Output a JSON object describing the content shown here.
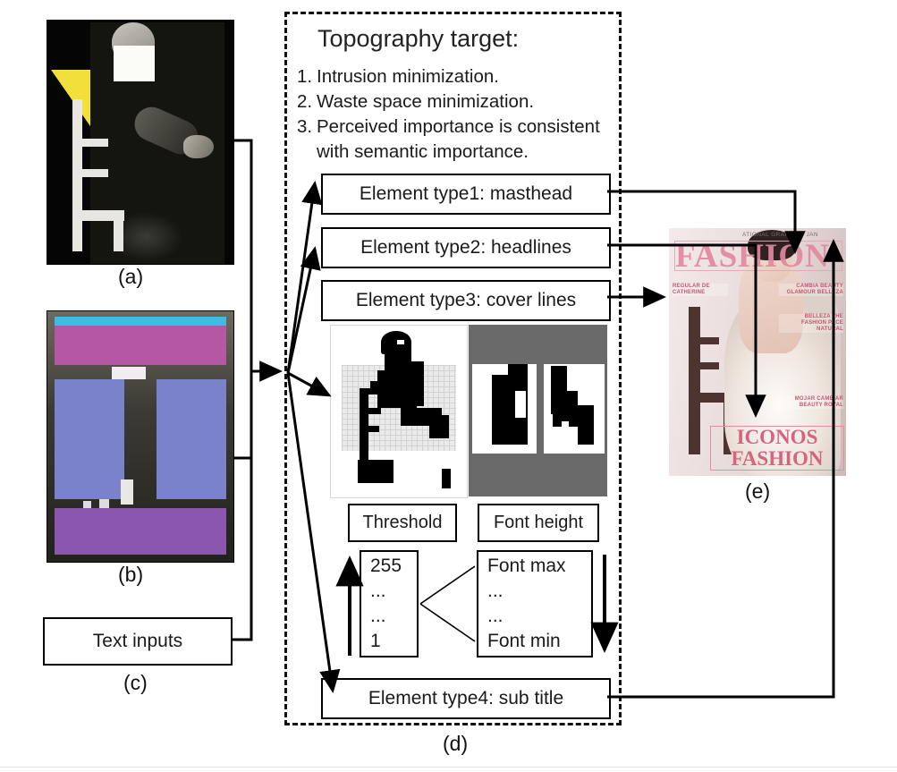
{
  "figure": {
    "panel_labels": {
      "a": "(a)",
      "b": "(b)",
      "c": "(c)",
      "d": "(d)",
      "e": "(e)"
    }
  },
  "topography": {
    "title": "Topography target:",
    "items": [
      {
        "num": "1.",
        "text": "Intrusion minimization."
      },
      {
        "num": "2.",
        "text": "Waste space minimization."
      },
      {
        "num": "3.",
        "text": "Perceived importance is consistent",
        "continuation": "with semantic importance."
      }
    ]
  },
  "element_types": [
    {
      "label": "Element type1: masthead"
    },
    {
      "label": "Element type2: headlines"
    },
    {
      "label": "Element type3: cover lines"
    },
    {
      "label": "Element type4: sub title"
    }
  ],
  "panels": {
    "threshold_label": "Threshold",
    "font_height_label": "Font height"
  },
  "threshold_values": [
    "255",
    "...",
    "...",
    "1"
  ],
  "font_values": [
    "Font max",
    "...",
    "...",
    "Font min"
  ],
  "inputs": {
    "text_inputs_label": "Text inputs"
  },
  "cover": {
    "top_line": "ATIONAL GRAPHICE JAN",
    "masthead": "FASHION",
    "cover_lines": {
      "left": "REGULAR DE CATHERINE",
      "right_1": "CAMBIA BEAUTY GLAMOUR BELLEZA",
      "right_2": "BELLEZA THE FASHION PACE NATURAL",
      "right_3": "MOJAR CAMBIAR BEAUTY ROYAL"
    },
    "sub_title_line1": "ICONOS",
    "sub_title_line2": "FASHION"
  },
  "colors": {
    "triangle": "#f2e03a",
    "mock_cyan": "#3fb9e6",
    "mock_magenta": "#b657a4",
    "mock_blue": "#7b82cc",
    "mock_purple": "#8a56b0",
    "font_panel_gray": "#6a6a6a",
    "cover_pink": "#d4657f",
    "stroke": "#000000"
  }
}
